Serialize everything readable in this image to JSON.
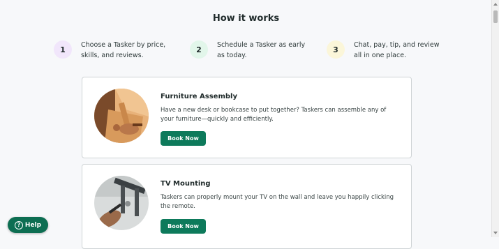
{
  "section": {
    "title": "How it works"
  },
  "steps": [
    {
      "number": "1",
      "text_line1": "Choose a Tasker by price,",
      "text_line2": "skills, and reviews.",
      "badge_color": "#f1e6fb"
    },
    {
      "number": "2",
      "text_line1": "Schedule a Tasker as early",
      "text_line2": "as today.",
      "badge_color": "#e2f6ea"
    },
    {
      "number": "3",
      "text_line1": "Chat, pay, tip, and review",
      "text_line2": "all in one place.",
      "badge_color": "#fbf6d9"
    }
  ],
  "cards": [
    {
      "title": "Furniture Assembly",
      "description": "Have a new desk or bookcase to put together? Taskers can assemble any of your furniture—quickly and efficiently.",
      "button_label": "Book Now",
      "image_icon": "furniture-assembly-photo"
    },
    {
      "title": "TV Mounting",
      "description": "Taskers can properly mount your TV on the wall and leave you happily clicking the remote.",
      "button_label": "Book Now",
      "image_icon": "tv-mounting-photo"
    }
  ],
  "help": {
    "label": "Help",
    "icon_glyph": "?"
  },
  "colors": {
    "primary_button": "#0d7a5b",
    "help_button": "#0d6e52",
    "page_background": "#f7f8fa"
  }
}
